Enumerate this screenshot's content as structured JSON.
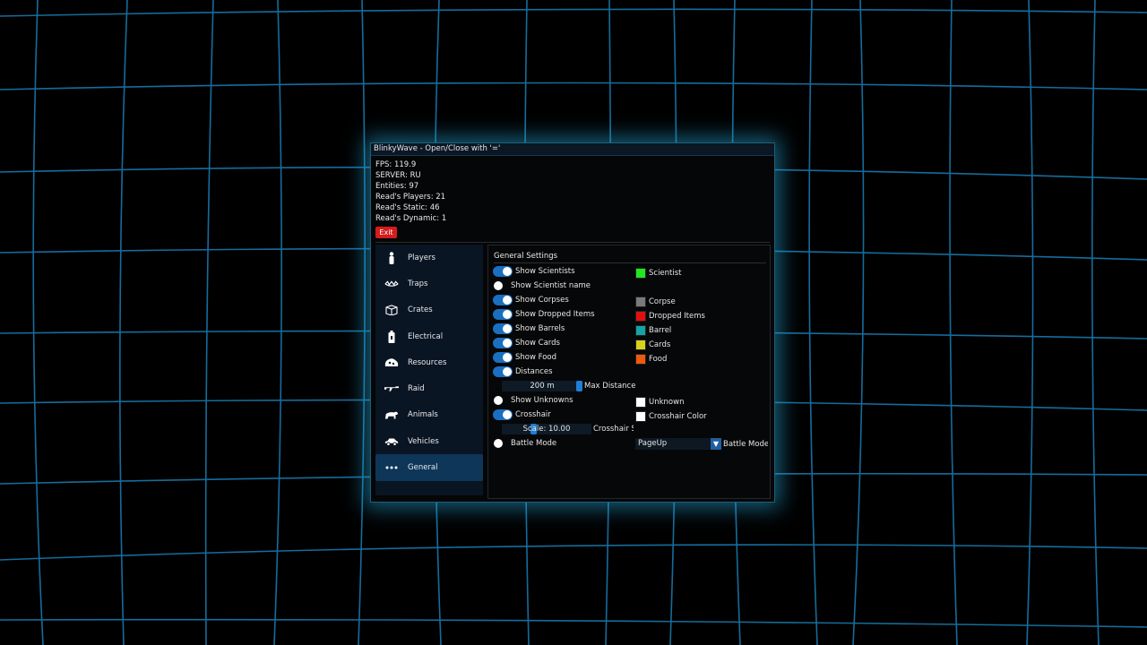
{
  "window": {
    "title": "BlinkyWave - Open/Close with '='"
  },
  "stats": {
    "fps": "FPS: 119.9",
    "server": "SERVER: RU",
    "entities": "Entities: 97",
    "players": "Read's Players: 21",
    "static": "Read's Static: 46",
    "dynamic": "Read's Dynamic: 1"
  },
  "exit_label": "Exit",
  "sidebar": {
    "items": [
      {
        "label": "Players",
        "icon": "person-icon"
      },
      {
        "label": "Traps",
        "icon": "trap-icon"
      },
      {
        "label": "Crates",
        "icon": "crate-icon"
      },
      {
        "label": "Electrical",
        "icon": "battery-icon"
      },
      {
        "label": "Resources",
        "icon": "ore-icon"
      },
      {
        "label": "Raid",
        "icon": "rifle-icon"
      },
      {
        "label": "Animals",
        "icon": "bear-icon"
      },
      {
        "label": "Vehicles",
        "icon": "car-icon"
      },
      {
        "label": "General",
        "icon": "more-icon"
      }
    ],
    "active": "General"
  },
  "general": {
    "title": "General Settings",
    "show_scientists": "Show Scientists",
    "show_scientist_name": "Show Scientist name",
    "show_corpses": "Show Corpses",
    "show_dropped_items": "Show Dropped Items",
    "show_barrels": "Show Barrels",
    "show_cards": "Show Cards",
    "show_food": "Show Food",
    "distances": "Distances",
    "distance_value": "200 m",
    "max_distance": "Max Distance",
    "show_unknowns": "Show Unknowns",
    "crosshair": "Crosshair",
    "scale_value": "Scale: 10.00",
    "crosshair_scale": "Crosshair S",
    "battle_mode": "Battle Mode",
    "battle_key": "PageUp",
    "battle_mode_key": "Battle Mode I"
  },
  "colors": {
    "scientist": {
      "label": "Scientist",
      "color": "#1ee81e"
    },
    "corpse": {
      "label": "Corpse",
      "color": "#7a7a7a"
    },
    "dropped": {
      "label": "Dropped Items",
      "color": "#e01010"
    },
    "barrel": {
      "label": "Barrel",
      "color": "#14a4a8"
    },
    "cards": {
      "label": "Cards",
      "color": "#d6d21c"
    },
    "food": {
      "label": "Food",
      "color": "#f0580e"
    },
    "unknown": {
      "label": "Unknown",
      "color": "#ffffff"
    },
    "crosshair_color": {
      "label": "Crosshair Color",
      "color": "#ffffff"
    }
  }
}
